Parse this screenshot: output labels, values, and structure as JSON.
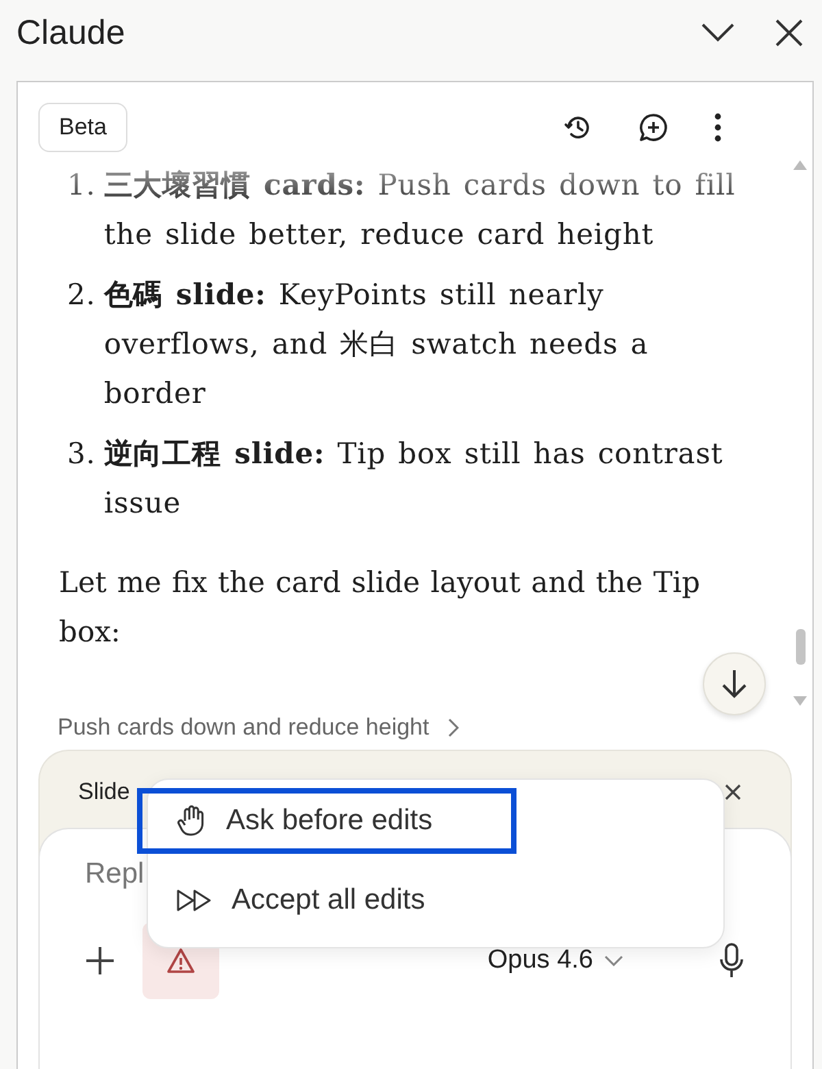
{
  "window": {
    "title": "Claude"
  },
  "toolbar": {
    "badge": "Beta"
  },
  "message": {
    "items": [
      {
        "number": "1.",
        "text": "**三大壞習慣 cards:** Push cards down to fill the slide better, reduce card height"
      },
      {
        "number": "2.",
        "text": "**色碼 slide:** KeyPoints still nearly overflows, and 米白 swatch needs a border"
      },
      {
        "number": "3.",
        "text": "**逆向工程 slide:** Tip box still has contrast issue"
      }
    ],
    "paragraph": "Let me fix the card slide layout and the Tip box:"
  },
  "step_link": "Push cards down and reduce height",
  "composer": {
    "attachment": "Slide",
    "placeholder": "Repl",
    "model": "Opus 4.6"
  },
  "mode_menu": {
    "items": [
      {
        "kind": "ask",
        "label": "Ask before edits",
        "selected": true
      },
      {
        "kind": "accept",
        "label": "Accept all edits",
        "selected": false
      }
    ]
  }
}
